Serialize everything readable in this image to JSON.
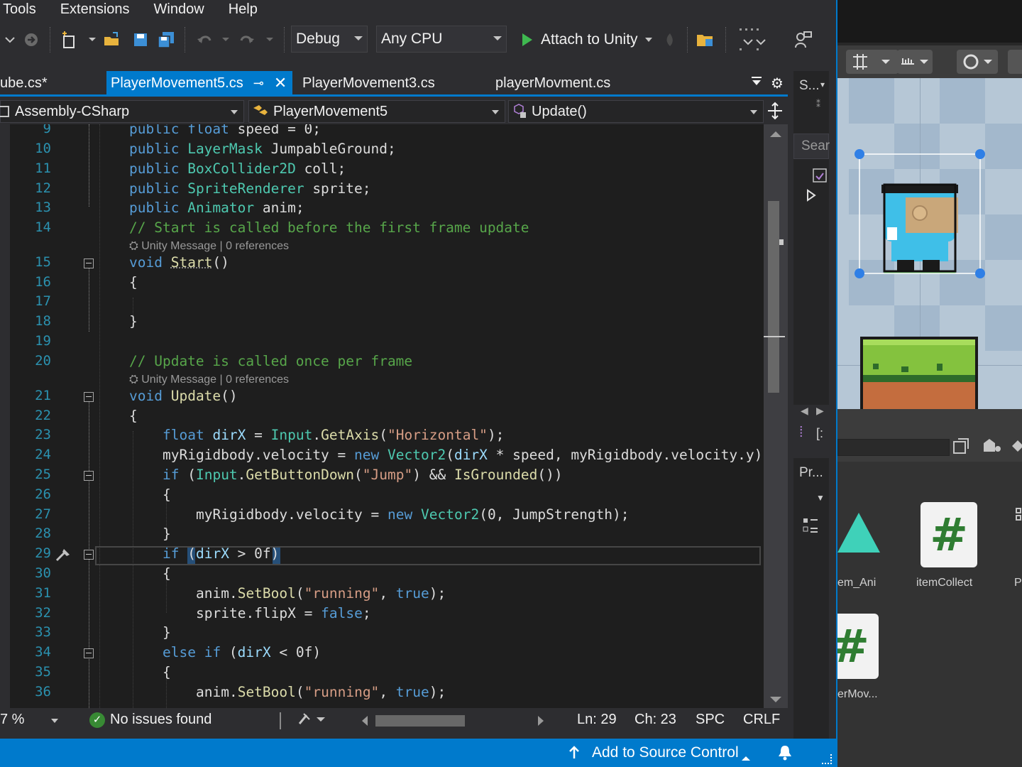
{
  "menu": [
    "Tools",
    "Extensions",
    "Window",
    "Help"
  ],
  "toolbar": {
    "configuration": "Debug",
    "platform": "Any CPU",
    "attach_label": "Attach to Unity",
    "icons": [
      "back-icon",
      "forward-icon",
      "new-project-icon",
      "open-folder-icon",
      "save-icon",
      "save-all-icon",
      "undo-icon",
      "redo-icon",
      "play-icon",
      "hot-reload-icon",
      "file-explorer-icon",
      "live-share-icon",
      "feedback-icon"
    ]
  },
  "tabs": [
    {
      "label": "cube.cs*",
      "active": false
    },
    {
      "label": "PlayerMovement5.cs",
      "active": true
    },
    {
      "label": "PlayerMovement3.cs",
      "active": false
    },
    {
      "label": "playerMovment.cs",
      "active": false
    }
  ],
  "navbar": {
    "project": "Assembly-CSharp",
    "class": "PlayerMovement5",
    "member": "Update()"
  },
  "editor": {
    "line_numbers": [
      "9",
      "10",
      "11",
      "12",
      "13",
      "14",
      "15",
      "16",
      "17",
      "18",
      "19",
      "20",
      "21",
      "22",
      "23",
      "24",
      "25",
      "26",
      "27",
      "28",
      "29",
      "30",
      "31",
      "32",
      "33",
      "34",
      "35",
      "36"
    ],
    "lens_text": "Unity Message | 0 references",
    "code": {
      "l9_a": "public float",
      "l9_b": " speed = 0;",
      "l10_a": "public",
      "l10_b": "LayerMask",
      "l10_c": " JumpableGround;",
      "l11_a": "public",
      "l11_b": "BoxCollider2D",
      "l11_c": " coll;",
      "l12_a": "public",
      "l12_b": "SpriteRenderer",
      "l12_c": " sprite;",
      "l13_a": "public",
      "l13_b": "Animator",
      "l13_c": " anim;",
      "l14": "// Start is called before the first frame update",
      "l15_a": "void",
      "l15_b": "Start",
      "l15_c": "()",
      "l16": "{",
      "l18": "}",
      "l20": "// Update is called once per frame",
      "l21_a": "void",
      "l21_b": "Update",
      "l21_c": "()",
      "l22": "{",
      "l23_a": "float",
      "l23_b": "dirX",
      "l23_c": " = ",
      "l23_d": "Input",
      "l23_e": ".",
      "l23_f": "GetAxis",
      "l23_g": "(",
      "l23_h": "\"Horizontal\"",
      "l23_i": ");",
      "l24_a": "myRigidbody.velocity = ",
      "l24_b": "new",
      "l24_c": "Vector2",
      "l24_d": "(",
      "l24_e": "dirX",
      "l24_f": " * speed, myRigidbody.velocity.y);",
      "l25_a": "if",
      "l25_b": " (",
      "l25_c": "Input",
      "l25_d": ".",
      "l25_e": "GetButtonDown",
      "l25_f": "(",
      "l25_g": "\"Jump\"",
      "l25_h": ") && ",
      "l25_i": "IsGrounded",
      "l25_j": "())",
      "l26": "{",
      "l27_a": "myRigidbody.velocity = ",
      "l27_b": "new",
      "l27_c": "Vector2",
      "l27_d": "(0, JumpStrength);",
      "l28": "}",
      "l29_a": "if",
      "l29_b": " (",
      "l29_c": "dirX",
      "l29_d": " > 0f)",
      "l30": "{",
      "l31_a": "anim.",
      "l31_b": "SetBool",
      "l31_c": "(",
      "l31_d": "\"running\"",
      "l31_e": ", ",
      "l31_f": "true",
      "l31_g": ");",
      "l32_a": "sprite.flipX = ",
      "l32_b": "false",
      "l32_c": ";",
      "l33": "}",
      "l34_a": "else if",
      "l34_b": " (",
      "l34_c": "dirX",
      "l34_d": " < 0f)",
      "l35": "{",
      "l36_a": "anim.",
      "l36_b": "SetBool",
      "l36_c": "(",
      "l36_d": "\"running\"",
      "l36_e": ", ",
      "l36_f": "true",
      "l36_g": ");"
    }
  },
  "editor_status": {
    "zoom": "7 %",
    "issues": "No issues found",
    "line": "Ln: 29",
    "char": "Ch: 23",
    "whitespace": "SPC",
    "line_ending": "CRLF"
  },
  "side_panel": {
    "top_label": "S...",
    "search_placeholder": "Sear",
    "bottom_label": "Pr..."
  },
  "statusbar": {
    "source_control": "Add to Source Control"
  },
  "unity": {
    "assets": [
      "em_Ani",
      "itemCollect",
      "P",
      "erMov..."
    ]
  },
  "colors": {
    "accent": "#007acc",
    "keyword": "#569cd6",
    "type": "#4ec9b0",
    "string": "#d69d85",
    "comment": "#57a64a",
    "method": "#dcdcaa",
    "line_number": "#2b91af"
  }
}
